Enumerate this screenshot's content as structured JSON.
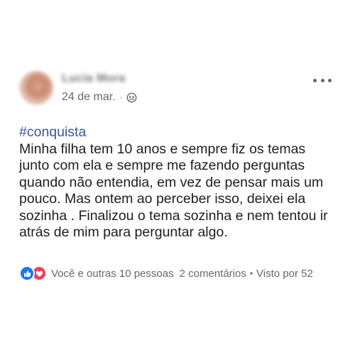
{
  "post": {
    "author": "Lucia Mora",
    "date": "24 de mar.",
    "separator": "·",
    "privacy_icon": "group-icon",
    "more_icon": "more-horizontal-icon",
    "hashtag": "#conquista",
    "lines": [
      "Minha filha tem 10 anos e sempre fiz os temas",
      "junto com ela e sempre me fazendo perguntas",
      "quando não entendia, em vez de pensar mais um",
      "pouco. Mas ontem ao perceber isso, deixei ela",
      "sozinha . Finalizou o tema sozinha e nem tentou ir",
      "atrás de mim para perguntar algo."
    ],
    "footer": {
      "reactions": [
        "like-icon",
        "love-icon"
      ],
      "reactors": "Você e outras 10 pessoas",
      "comments": "2 comentários",
      "separator": "•",
      "views": "Visto por 52"
    },
    "colors": {
      "hashtag": "#385898",
      "like": "#1877f2",
      "love": "#f33e58",
      "meta": "#65676b"
    }
  }
}
